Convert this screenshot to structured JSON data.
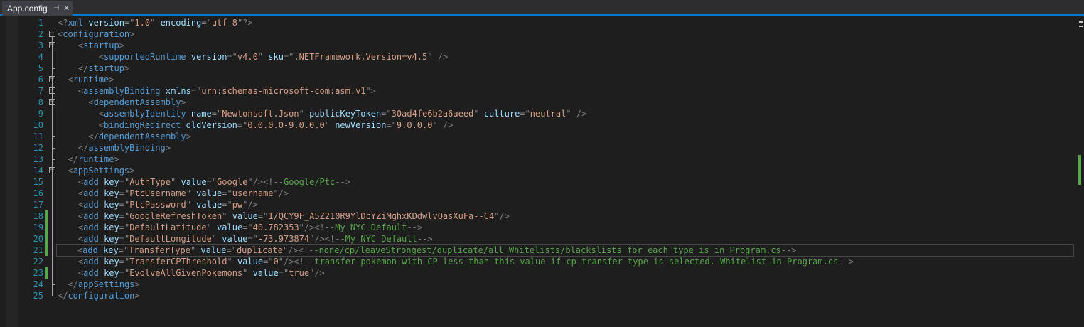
{
  "tab": {
    "title": "App.config",
    "pin_icon": "⊣",
    "close_icon": "✕"
  },
  "line_numbers": [
    "1",
    "2",
    "3",
    "4",
    "5",
    "6",
    "7",
    "8",
    "9",
    "10",
    "11",
    "12",
    "13",
    "14",
    "15",
    "16",
    "17",
    "18",
    "19",
    "20",
    "21",
    "22",
    "23",
    "24",
    "25"
  ],
  "current_line": 21,
  "changed_lines": [
    18,
    19,
    20,
    21,
    23
  ],
  "code_lines": [
    [
      [
        "d",
        "<?"
      ],
      [
        "e",
        "xml"
      ],
      [
        "p",
        " "
      ],
      [
        "a",
        "version"
      ],
      [
        "d",
        "=\""
      ],
      [
        "v",
        "1.0"
      ],
      [
        "d",
        "\""
      ],
      [
        "p",
        " "
      ],
      [
        "a",
        "encoding"
      ],
      [
        "d",
        "=\""
      ],
      [
        "v",
        "utf-8"
      ],
      [
        "d",
        "\"?>"
      ]
    ],
    [
      [
        "d",
        "<"
      ],
      [
        "e",
        "configuration"
      ],
      [
        "d",
        ">"
      ]
    ],
    [
      [
        "p",
        "    "
      ],
      [
        "d",
        "<"
      ],
      [
        "e",
        "startup"
      ],
      [
        "d",
        ">"
      ]
    ],
    [
      [
        "p",
        "        "
      ],
      [
        "d",
        "<"
      ],
      [
        "e",
        "supportedRuntime"
      ],
      [
        "p",
        " "
      ],
      [
        "a",
        "version"
      ],
      [
        "d",
        "=\""
      ],
      [
        "v",
        "v4.0"
      ],
      [
        "d",
        "\""
      ],
      [
        "p",
        " "
      ],
      [
        "a",
        "sku"
      ],
      [
        "d",
        "=\""
      ],
      [
        "v",
        ".NETFramework,Version=v4.5"
      ],
      [
        "d",
        "\" />"
      ]
    ],
    [
      [
        "p",
        "    "
      ],
      [
        "d",
        "</"
      ],
      [
        "e",
        "startup"
      ],
      [
        "d",
        ">"
      ]
    ],
    [
      [
        "p",
        "  "
      ],
      [
        "d",
        "<"
      ],
      [
        "e",
        "runtime"
      ],
      [
        "d",
        ">"
      ]
    ],
    [
      [
        "p",
        "    "
      ],
      [
        "d",
        "<"
      ],
      [
        "e",
        "assemblyBinding"
      ],
      [
        "p",
        " "
      ],
      [
        "a",
        "xmlns"
      ],
      [
        "d",
        "=\""
      ],
      [
        "v",
        "urn:schemas-microsoft-com:asm.v1"
      ],
      [
        "d",
        "\">"
      ]
    ],
    [
      [
        "p",
        "      "
      ],
      [
        "d",
        "<"
      ],
      [
        "e",
        "dependentAssembly"
      ],
      [
        "d",
        ">"
      ]
    ],
    [
      [
        "p",
        "        "
      ],
      [
        "d",
        "<"
      ],
      [
        "e",
        "assemblyIdentity"
      ],
      [
        "p",
        " "
      ],
      [
        "a",
        "name"
      ],
      [
        "d",
        "=\""
      ],
      [
        "v",
        "Newtonsoft.Json"
      ],
      [
        "d",
        "\""
      ],
      [
        "p",
        " "
      ],
      [
        "a",
        "publicKeyToken"
      ],
      [
        "d",
        "=\""
      ],
      [
        "v",
        "30ad4fe6b2a6aeed"
      ],
      [
        "d",
        "\""
      ],
      [
        "p",
        " "
      ],
      [
        "a",
        "culture"
      ],
      [
        "d",
        "=\""
      ],
      [
        "v",
        "neutral"
      ],
      [
        "d",
        "\" />"
      ]
    ],
    [
      [
        "p",
        "        "
      ],
      [
        "d",
        "<"
      ],
      [
        "e",
        "bindingRedirect"
      ],
      [
        "p",
        " "
      ],
      [
        "a",
        "oldVersion"
      ],
      [
        "d",
        "=\""
      ],
      [
        "v",
        "0.0.0.0-9.0.0.0"
      ],
      [
        "d",
        "\""
      ],
      [
        "p",
        " "
      ],
      [
        "a",
        "newVersion"
      ],
      [
        "d",
        "=\""
      ],
      [
        "v",
        "9.0.0.0"
      ],
      [
        "d",
        "\" />"
      ]
    ],
    [
      [
        "p",
        "      "
      ],
      [
        "d",
        "</"
      ],
      [
        "e",
        "dependentAssembly"
      ],
      [
        "d",
        ">"
      ]
    ],
    [
      [
        "p",
        "    "
      ],
      [
        "d",
        "</"
      ],
      [
        "e",
        "assemblyBinding"
      ],
      [
        "d",
        ">"
      ]
    ],
    [
      [
        "p",
        "  "
      ],
      [
        "d",
        "</"
      ],
      [
        "e",
        "runtime"
      ],
      [
        "d",
        ">"
      ]
    ],
    [
      [
        "p",
        "  "
      ],
      [
        "d",
        "<"
      ],
      [
        "e",
        "appSettings"
      ],
      [
        "d",
        ">"
      ]
    ],
    [
      [
        "p",
        "    "
      ],
      [
        "d",
        "<"
      ],
      [
        "e",
        "add"
      ],
      [
        "p",
        " "
      ],
      [
        "a",
        "key"
      ],
      [
        "d",
        "=\""
      ],
      [
        "v",
        "AuthType"
      ],
      [
        "d",
        "\""
      ],
      [
        "p",
        " "
      ],
      [
        "a",
        "value"
      ],
      [
        "d",
        "=\""
      ],
      [
        "v",
        "Google"
      ],
      [
        "d",
        "\"/><!--"
      ],
      [
        "c",
        "Google/Ptc"
      ],
      [
        "d",
        "-->"
      ]
    ],
    [
      [
        "p",
        "    "
      ],
      [
        "d",
        "<"
      ],
      [
        "e",
        "add"
      ],
      [
        "p",
        " "
      ],
      [
        "a",
        "key"
      ],
      [
        "d",
        "=\""
      ],
      [
        "v",
        "PtcUsername"
      ],
      [
        "d",
        "\""
      ],
      [
        "p",
        " "
      ],
      [
        "a",
        "value"
      ],
      [
        "d",
        "=\""
      ],
      [
        "v",
        "username"
      ],
      [
        "d",
        "\"/>"
      ]
    ],
    [
      [
        "p",
        "    "
      ],
      [
        "d",
        "<"
      ],
      [
        "e",
        "add"
      ],
      [
        "p",
        " "
      ],
      [
        "a",
        "key"
      ],
      [
        "d",
        "=\""
      ],
      [
        "v",
        "PtcPassword"
      ],
      [
        "d",
        "\""
      ],
      [
        "p",
        " "
      ],
      [
        "a",
        "value"
      ],
      [
        "d",
        "=\""
      ],
      [
        "v",
        "pw"
      ],
      [
        "d",
        "\"/>"
      ]
    ],
    [
      [
        "p",
        "    "
      ],
      [
        "d",
        "<"
      ],
      [
        "e",
        "add"
      ],
      [
        "p",
        " "
      ],
      [
        "a",
        "key"
      ],
      [
        "d",
        "=\""
      ],
      [
        "v",
        "GoogleRefreshToken"
      ],
      [
        "d",
        "\""
      ],
      [
        "p",
        " "
      ],
      [
        "a",
        "value"
      ],
      [
        "d",
        "=\""
      ],
      [
        "v",
        "1/QCY9F_A5Z210R9YlDcYZiMghxKDdwlvQasXuFa--C4"
      ],
      [
        "d",
        "\"/>"
      ]
    ],
    [
      [
        "p",
        "    "
      ],
      [
        "d",
        "<"
      ],
      [
        "e",
        "add"
      ],
      [
        "p",
        " "
      ],
      [
        "a",
        "key"
      ],
      [
        "d",
        "=\""
      ],
      [
        "v",
        "DefaultLatitude"
      ],
      [
        "d",
        "\""
      ],
      [
        "p",
        " "
      ],
      [
        "a",
        "value"
      ],
      [
        "d",
        "=\""
      ],
      [
        "v",
        "40.782353"
      ],
      [
        "d",
        "\"/><!--"
      ],
      [
        "c",
        "My NYC Default"
      ],
      [
        "d",
        "-->"
      ]
    ],
    [
      [
        "p",
        "    "
      ],
      [
        "d",
        "<"
      ],
      [
        "e",
        "add"
      ],
      [
        "p",
        " "
      ],
      [
        "a",
        "key"
      ],
      [
        "d",
        "=\""
      ],
      [
        "v",
        "DefaultLongitude"
      ],
      [
        "d",
        "\""
      ],
      [
        "p",
        " "
      ],
      [
        "a",
        "value"
      ],
      [
        "d",
        "=\""
      ],
      [
        "v",
        "-73.973874"
      ],
      [
        "d",
        "\"/><!--"
      ],
      [
        "c",
        "My NYC Default"
      ],
      [
        "d",
        "-->"
      ]
    ],
    [
      [
        "p",
        "    "
      ],
      [
        "d",
        "<"
      ],
      [
        "e",
        "add"
      ],
      [
        "p",
        " "
      ],
      [
        "a",
        "key"
      ],
      [
        "d",
        "=\""
      ],
      [
        "v",
        "TransferType"
      ],
      [
        "d",
        "\""
      ],
      [
        "p",
        " "
      ],
      [
        "a",
        "value"
      ],
      [
        "d",
        "=\""
      ],
      [
        "v",
        "duplicate"
      ],
      [
        "d",
        "\"/><!--"
      ],
      [
        "c",
        "none/cp/leaveStrongest/duplicate/all Whitelists/blackslists for each type is in Program.cs"
      ],
      [
        "d",
        "-->"
      ]
    ],
    [
      [
        "p",
        "    "
      ],
      [
        "d",
        "<"
      ],
      [
        "e",
        "add"
      ],
      [
        "p",
        " "
      ],
      [
        "a",
        "key"
      ],
      [
        "d",
        "=\""
      ],
      [
        "v",
        "TransferCPThreshold"
      ],
      [
        "d",
        "\""
      ],
      [
        "p",
        " "
      ],
      [
        "a",
        "value"
      ],
      [
        "d",
        "=\""
      ],
      [
        "v",
        "0"
      ],
      [
        "d",
        "\"/><!--"
      ],
      [
        "c",
        "transfer pokemon with CP less than this value if cp transfer type is selected. Whitelist in Program.cs"
      ],
      [
        "d",
        "-->"
      ]
    ],
    [
      [
        "p",
        "    "
      ],
      [
        "d",
        "<"
      ],
      [
        "e",
        "add"
      ],
      [
        "p",
        " "
      ],
      [
        "a",
        "key"
      ],
      [
        "d",
        "=\""
      ],
      [
        "v",
        "EvolveAllGivenPokemons"
      ],
      [
        "d",
        "\""
      ],
      [
        "p",
        " "
      ],
      [
        "a",
        "value"
      ],
      [
        "d",
        "=\""
      ],
      [
        "v",
        "true"
      ],
      [
        "d",
        "\"/>"
      ]
    ],
    [
      [
        "p",
        "  "
      ],
      [
        "d",
        "</"
      ],
      [
        "e",
        "appSettings"
      ],
      [
        "d",
        ">"
      ]
    ],
    [
      [
        "d",
        "</"
      ],
      [
        "e",
        "configuration"
      ],
      [
        "d",
        ">"
      ]
    ]
  ],
  "fold_markers": [
    2,
    3,
    6,
    7,
    8,
    14
  ],
  "colors": {
    "element": "#569cd6",
    "attribute": "#9cdcfe",
    "value": "#d69d85",
    "delimiter": "#808080",
    "comment": "#57a64a",
    "line_number": "#2b91af",
    "change_marker": "#57a64a"
  }
}
